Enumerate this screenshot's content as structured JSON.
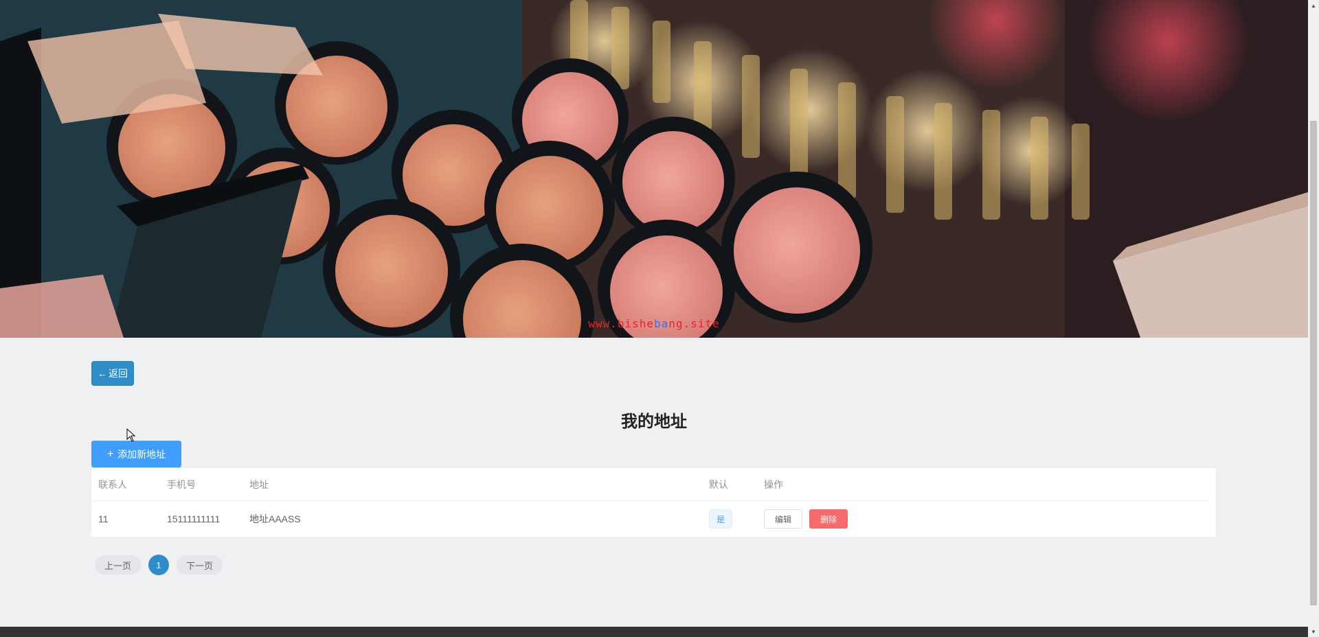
{
  "banner": {
    "watermark_pre": "www.bishe",
    "watermark_mid": "ba",
    "watermark_post": "ng.site"
  },
  "nav": {
    "back_icon": "arrow-left-icon",
    "back_label": "返回"
  },
  "page_title": "我的地址",
  "toolbar": {
    "add_icon": "plus-icon",
    "add_label": "添加新地址"
  },
  "table": {
    "columns": [
      "联系人",
      "手机号",
      "地址",
      "默认",
      "操作"
    ],
    "rows": [
      {
        "name": "11",
        "phone": "15111111111",
        "address": "地址AAASS",
        "default": "是",
        "edit_label": "编辑",
        "delete_label": "删除"
      }
    ]
  },
  "pagination": {
    "prev_label": "上一页",
    "current_page": "1",
    "next_label": "下一页"
  },
  "colors": {
    "primary": "#409eff",
    "accent": "#2e8dc8",
    "danger": "#f56c6c",
    "watermark": "#e3262e"
  }
}
